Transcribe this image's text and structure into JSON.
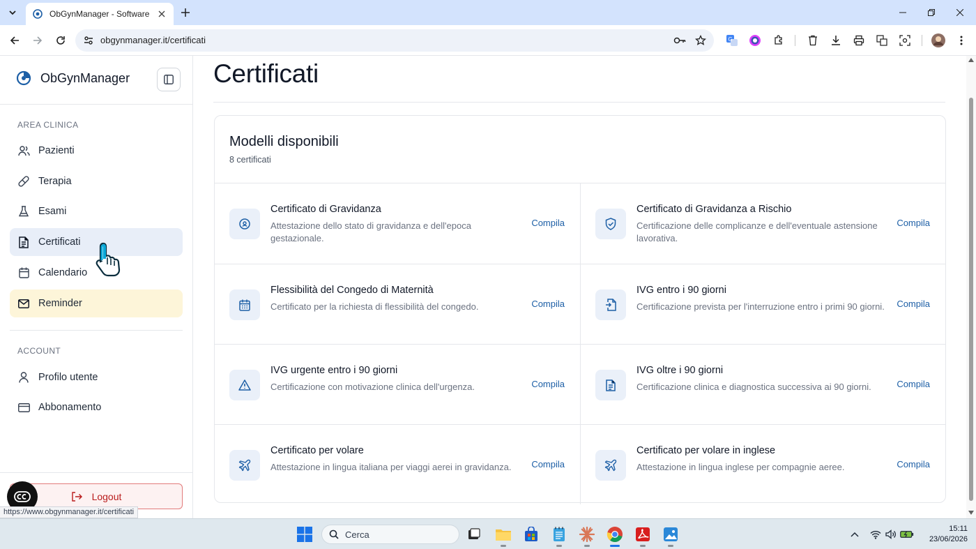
{
  "browser": {
    "tab_title": "ObGynManager - Software Ges",
    "url": "obgynmanager.it/certificati",
    "status_url": "https://www.obgynmanager.it/certificati"
  },
  "sidebar": {
    "brand": "ObGynManager",
    "section_clinical": "AREA CLINICA",
    "section_account": "ACCOUNT",
    "items": [
      {
        "label": "Pazienti",
        "icon": "users-icon"
      },
      {
        "label": "Terapia",
        "icon": "pill-icon"
      },
      {
        "label": "Esami",
        "icon": "flask-icon"
      },
      {
        "label": "Certificati",
        "icon": "file-text-icon",
        "active": true
      },
      {
        "label": "Calendario",
        "icon": "calendar-icon"
      },
      {
        "label": "Reminder",
        "icon": "mail-icon",
        "highlight": true
      }
    ],
    "account_items": [
      {
        "label": "Profilo utente",
        "icon": "user-icon"
      },
      {
        "label": "Abbonamento",
        "icon": "credit-card-icon"
      }
    ],
    "logout_label": "Logout"
  },
  "main": {
    "page_title": "Certificati",
    "card_title": "Modelli disponibili",
    "card_subtitle": "8 certificati",
    "action_label": "Compila",
    "certificates": [
      {
        "title": "Certificato di Gravidanza",
        "desc": "Attestazione dello stato di gravidanza e dell'epoca gestazionale.",
        "icon": "baby-icon"
      },
      {
        "title": "Certificato di Gravidanza a Rischio",
        "desc": "Certificazione delle complicanze e dell'eventuale astensione lavorativa.",
        "icon": "shield-check-icon"
      },
      {
        "title": "Flessibilità del Congedo di Maternità",
        "desc": "Certificato per la richiesta di flessibilità del congedo.",
        "icon": "calendar-icon"
      },
      {
        "title": "IVG entro i 90 giorni",
        "desc": "Certificazione prevista per l'interruzione entro i primi 90 giorni.",
        "icon": "file-input-icon"
      },
      {
        "title": "IVG urgente entro i 90 giorni",
        "desc": "Certificazione con motivazione clinica dell'urgenza.",
        "icon": "alert-triangle-icon"
      },
      {
        "title": "IVG oltre i 90 giorni",
        "desc": "Certificazione clinica e diagnostica successiva ai 90 giorni.",
        "icon": "file-text-icon"
      },
      {
        "title": "Certificato per volare",
        "desc": "Attestazione in lingua italiana per viaggi aerei in gravidanza.",
        "icon": "plane-icon"
      },
      {
        "title": "Certificato per volare in inglese",
        "desc": "Attestazione in lingua inglese per compagnie aeree.",
        "icon": "plane-icon"
      }
    ]
  },
  "taskbar": {
    "search_placeholder": "Cerca",
    "time": "15:11",
    "date": "23/06/2026"
  },
  "colors": {
    "accent": "#1d5fa6",
    "active_nav": "#e8eef8",
    "reminder_nav": "#fdf5d9",
    "logout_border": "#e27a7a",
    "icon_tile": "#eaf0f9"
  }
}
